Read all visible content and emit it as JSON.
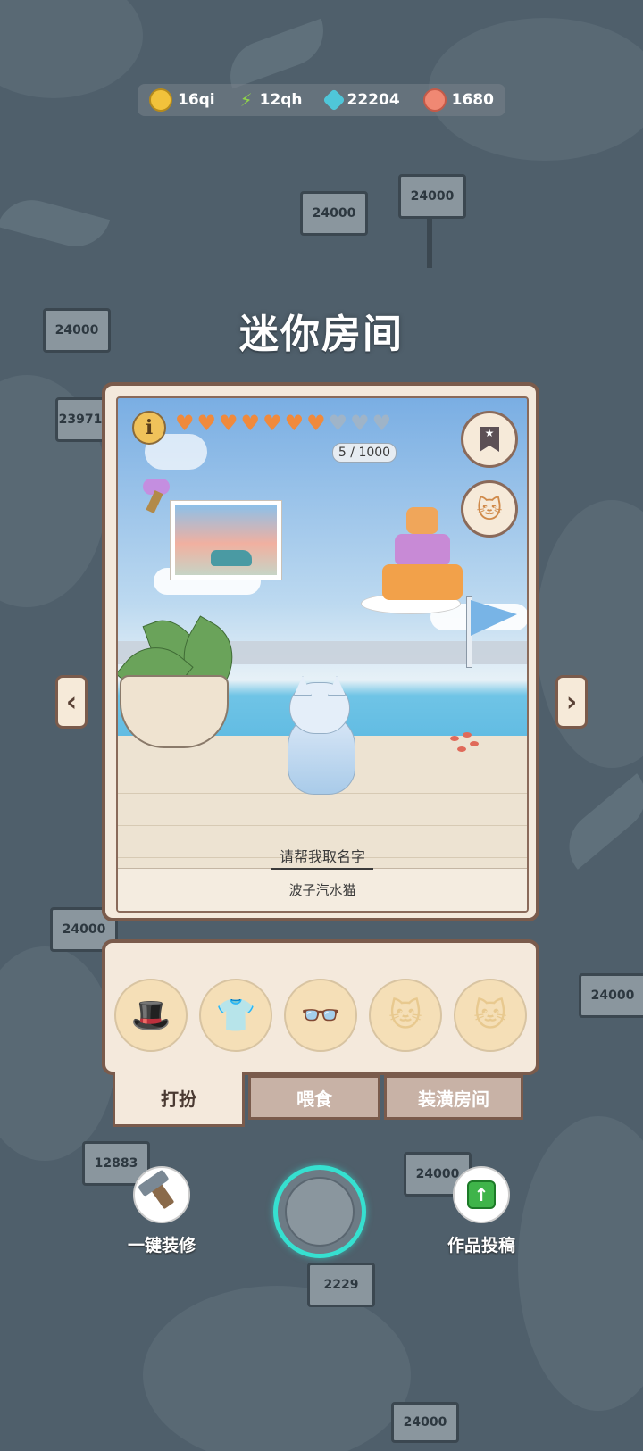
{
  "currencies": [
    {
      "name": "coin",
      "value": "16qi",
      "icon": "coin-icon"
    },
    {
      "name": "energy",
      "value": "12qh",
      "icon": "lightning-icon"
    },
    {
      "name": "gem",
      "value": "22204",
      "icon": "gem-icon"
    },
    {
      "name": "shell",
      "value": "1680",
      "icon": "shell-icon"
    }
  ],
  "page_title": "迷你房间",
  "room": {
    "hearts_filled": 7,
    "hearts_total": 10,
    "progress": "5 / 1000",
    "name_prompt": "请帮我取名字",
    "breed": "波子汽水猫"
  },
  "tabs": [
    {
      "label": "打扮",
      "active": true
    },
    {
      "label": "喂食",
      "active": false
    },
    {
      "label": "装潢房间",
      "active": false
    }
  ],
  "outfit_slots": [
    "hat-slot",
    "shirt-slot",
    "glasses-slot",
    "cat-face-slot",
    "cat-face-slot"
  ],
  "actions": {
    "repair_label": "一键装修",
    "submit_label": "作品投稿"
  },
  "background_signs": [
    "24000",
    "24000",
    "23971",
    "24000",
    "24000",
    "12883",
    "2229",
    "24000",
    "24000"
  ],
  "colors": {
    "frame_border": "#7a5b4c",
    "panel_bg": "#f4e9dc",
    "heart_full": "#f08a3c",
    "heart_empty": "#9fb4c8",
    "center_ring": "#36e0d0"
  }
}
